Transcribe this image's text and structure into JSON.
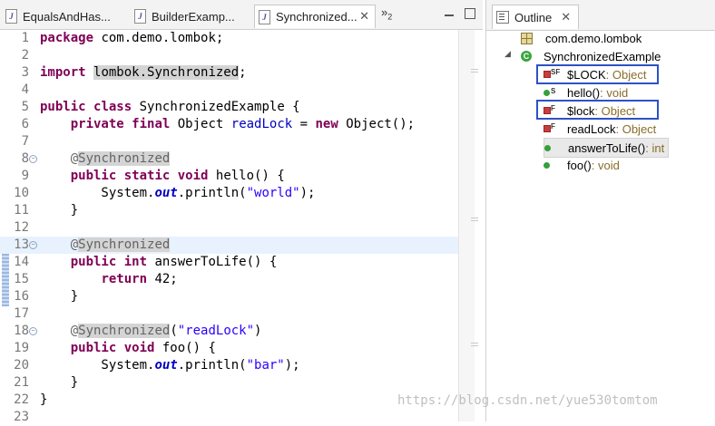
{
  "editor": {
    "tabs": [
      {
        "label": "EqualsAndHas...",
        "active": false
      },
      {
        "label": "BuilderExamp...",
        "active": false
      },
      {
        "label": "Synchronized...",
        "active": true
      }
    ],
    "overflow": {
      "symbol": "»",
      "count": "2"
    },
    "lines": [
      {
        "num": "1",
        "html": "<span class='kw'>package</span> com.demo.lombok;"
      },
      {
        "num": "2",
        "html": ""
      },
      {
        "num": "3",
        "html": "<span class='kw'>import</span> <span class='imphl'>lombok.Synchronized</span>;"
      },
      {
        "num": "4",
        "html": ""
      },
      {
        "num": "5",
        "html": "<span class='kw'>public</span> <span class='kw'>class</span> SynchronizedExample {"
      },
      {
        "num": "6",
        "html": "    <span class='kw'>private</span> <span class='kw'>final</span> Object <span class='fld'>readLock</span> = <span class='kw'>new</span> Object();"
      },
      {
        "num": "7",
        "html": ""
      },
      {
        "num": "8",
        "html": "    <span class='an'>@<span class='anbox'>Synchronized</span></span>",
        "fold": true
      },
      {
        "num": "9",
        "html": "    <span class='kw'>public</span> <span class='kw'>static</span> <span class='kw'>void</span> hello() {"
      },
      {
        "num": "10",
        "html": "        System.<span class='sfld'>out</span>.println(<span class='str'>\"world\"</span>);"
      },
      {
        "num": "11",
        "html": "    }"
      },
      {
        "num": "12",
        "html": ""
      },
      {
        "num": "13",
        "html": "    <span class='an'>@<span class='anbox'>Synchronized</span></span>",
        "fold": true,
        "hl": true
      },
      {
        "num": "14",
        "html": "    <span class='kw'>public</span> <span class='kw'>int</span> answerToLife() {"
      },
      {
        "num": "15",
        "html": "        <span class='kw'>return</span> 42;"
      },
      {
        "num": "16",
        "html": "    }"
      },
      {
        "num": "17",
        "html": ""
      },
      {
        "num": "18",
        "html": "    <span class='an'>@<span class='anbox'>Synchronized</span></span>(<span class='str'>\"readLock\"</span>)",
        "fold": true
      },
      {
        "num": "19",
        "html": "    <span class='kw'>public</span> <span class='kw'>void</span> foo() {"
      },
      {
        "num": "20",
        "html": "        System.<span class='sfld'>out</span>.println(<span class='str'>\"bar\"</span>);"
      },
      {
        "num": "21",
        "html": "    }"
      },
      {
        "num": "22",
        "html": "}"
      },
      {
        "num": "23",
        "html": ""
      }
    ]
  },
  "outline": {
    "title": "Outline",
    "package": "com.demo.lombok",
    "class_name": "SynchronizedExample",
    "class_icon_letter": "C",
    "members": [
      {
        "name": "$LOCK",
        "type": " : Object",
        "icon": "private-field",
        "mod": "SF"
      },
      {
        "name": "hello()",
        "type": " : void",
        "icon": "public-method",
        "mod": "S"
      },
      {
        "name": "$lock",
        "type": " : Object",
        "icon": "private-field",
        "mod": "F"
      },
      {
        "name": "readLock",
        "type": " : Object",
        "icon": "private-field",
        "mod": "F"
      },
      {
        "name": "answerToLife()",
        "type": " : int",
        "icon": "public-method",
        "mod": "",
        "selected": true
      },
      {
        "name": "foo()",
        "type": " : void",
        "icon": "public-method",
        "mod": ""
      }
    ]
  },
  "watermark": "https://blog.csdn.net/yue530tomtom",
  "colors": {
    "keyword": "#7f0055",
    "string": "#2a00ff",
    "field": "#0000c0",
    "callout": "#2c52c6"
  }
}
